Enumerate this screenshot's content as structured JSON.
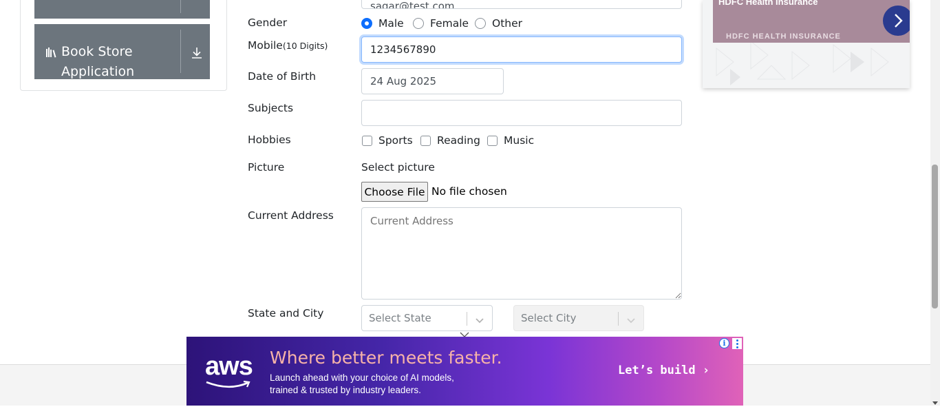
{
  "sidebar": {
    "book_store_label": "Book Store Application"
  },
  "form": {
    "email_value": "sagar@test.com",
    "gender_label": "Gender",
    "gender_options": [
      "Male",
      "Female",
      "Other"
    ],
    "gender_selected": "Male",
    "mobile_label": "Mobile",
    "mobile_hint": "(10 Digits)",
    "mobile_value": "1234567890",
    "dob_label": "Date of Birth",
    "dob_value": "24 Aug 2025",
    "subjects_label": "Subjects",
    "subjects_value": "",
    "hobbies_label": "Hobbies",
    "hobbies": [
      "Sports",
      "Reading",
      "Music"
    ],
    "picture_label": "Picture",
    "picture_select_text": "Select picture",
    "choose_file_label": "Choose File",
    "no_file_text": "No file chosen",
    "address_label": "Current Address",
    "address_placeholder": "Current Address",
    "state_city_label": "State and City",
    "state_placeholder": "Select State",
    "city_placeholder": "Select City"
  },
  "ads": {
    "hdfc_title": "HDFC Health Insurance",
    "hdfc_subtitle": "HDFC HEALTH INSURANCE",
    "aws_logo": "aws",
    "aws_headline": "Where better meets faster.",
    "aws_body_line1": "Launch ahead with your choice of AI models,",
    "aws_body_line2": "trained & trusted by industry leaders.",
    "aws_cta": "Let’s build ›"
  },
  "colors": {
    "primary": "#0d6efd",
    "sidebar_button": "#6c757d",
    "aws_headline": "#f7b3a8",
    "hdfc_banner": "#a88a9a",
    "hdfc_arrow": "#2a3b8f"
  }
}
